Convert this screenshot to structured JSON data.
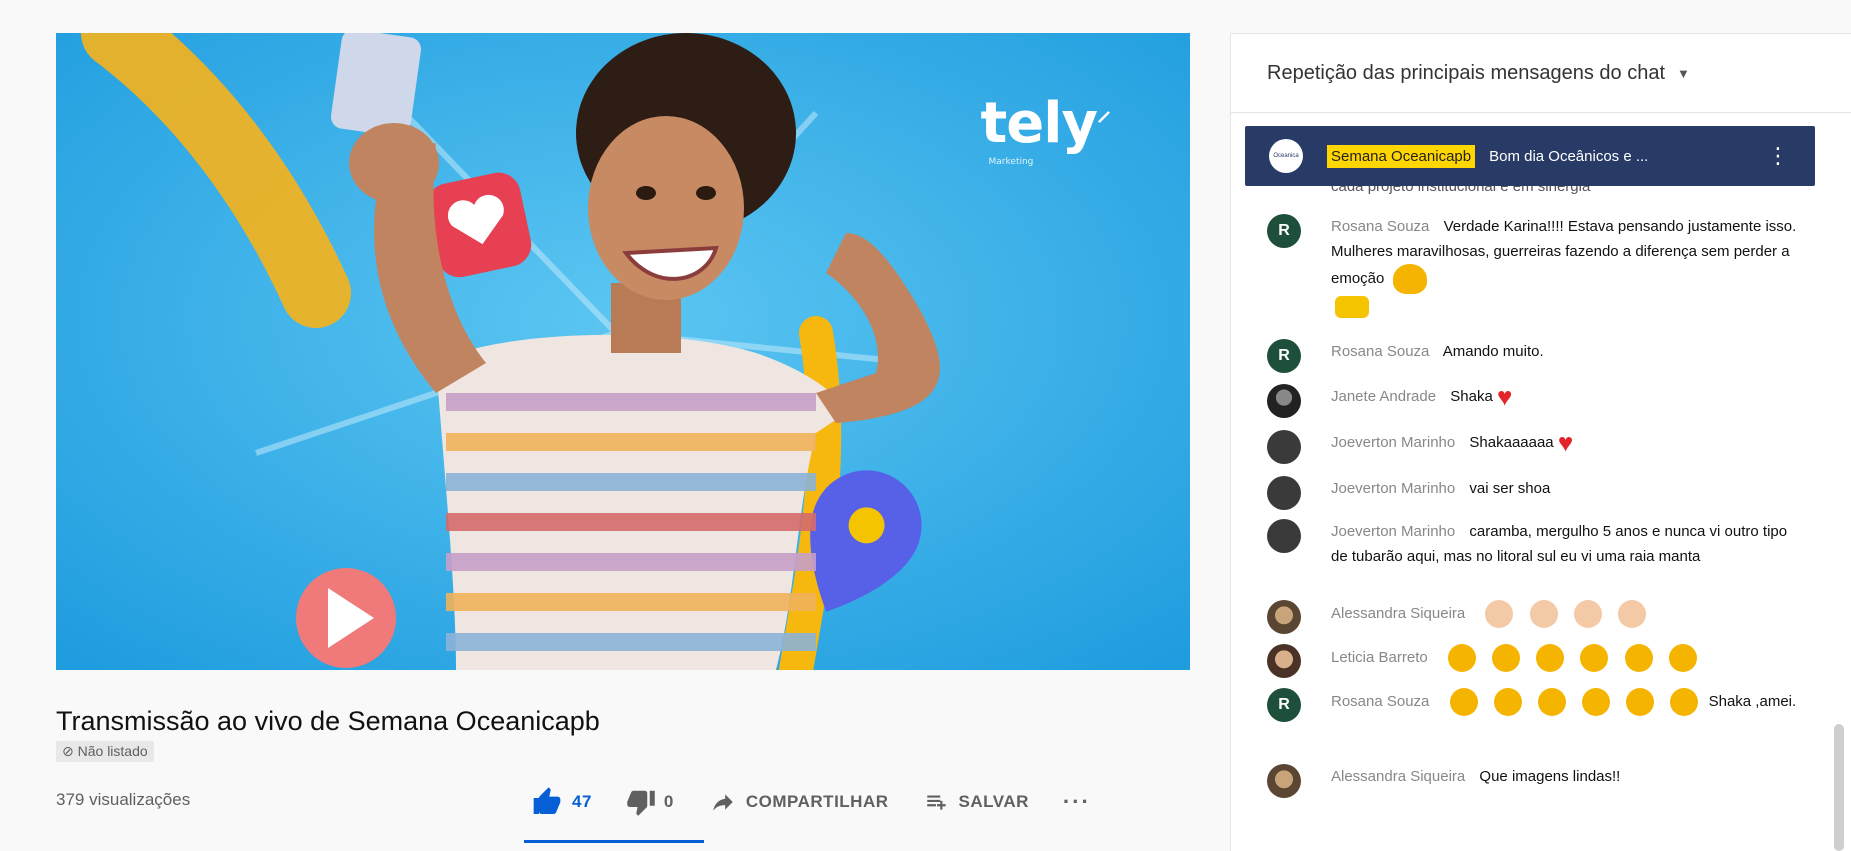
{
  "video": {
    "brand_logo": "tely",
    "brand_sub": "Marketing",
    "title": "Transmissão ao vivo de Semana Oceanicapb",
    "visibility": "Não listado",
    "views": "379 visualizações",
    "likes": "47",
    "dislikes": "0",
    "share_label": "COMPARTILHAR",
    "save_label": "SALVAR",
    "more_label": "···"
  },
  "chat": {
    "header": "Repetição das principais mensagens do chat",
    "pinned": {
      "avatar_label": "Oceanica",
      "author": "Semana Oceanicapb",
      "text": "Bom dia Oceânicos e ..."
    },
    "cut_text": "cada projeto institucional e em sinergia",
    "messages": [
      {
        "author": "Rosana Souza",
        "text": "Verdade Karina!!!! Estava pensando justamente isso. Mulheres maravilhosas, guerreiras fazendo a diferença sem perder a emoção",
        "avatar": "R"
      },
      {
        "author": "Rosana Souza",
        "text": "Amando muito.",
        "avatar": "R"
      },
      {
        "author": "Janete Andrade",
        "text": "Shaka",
        "avatar": ""
      },
      {
        "author": "Joeverton Marinho",
        "text": "Shakaaaaaa",
        "avatar": ""
      },
      {
        "author": "Joeverton Marinho",
        "text": "vai ser shoa",
        "avatar": ""
      },
      {
        "author": "Joeverton Marinho",
        "text": "caramba, mergulho 5 anos e nunca vi outro tipo de tubarão aqui, mas no litoral sul eu vi uma raia manta",
        "avatar": ""
      },
      {
        "author": "Alessandra Siqueira",
        "text": "",
        "avatar": ""
      },
      {
        "author": "Leticia Barreto",
        "text": "",
        "avatar": ""
      },
      {
        "author": "Rosana Souza",
        "text": "Shaka ,amei.",
        "avatar": "R"
      },
      {
        "author": "Alessandra Siqueira",
        "text": "Que imagens lindas!!",
        "avatar": ""
      }
    ]
  }
}
